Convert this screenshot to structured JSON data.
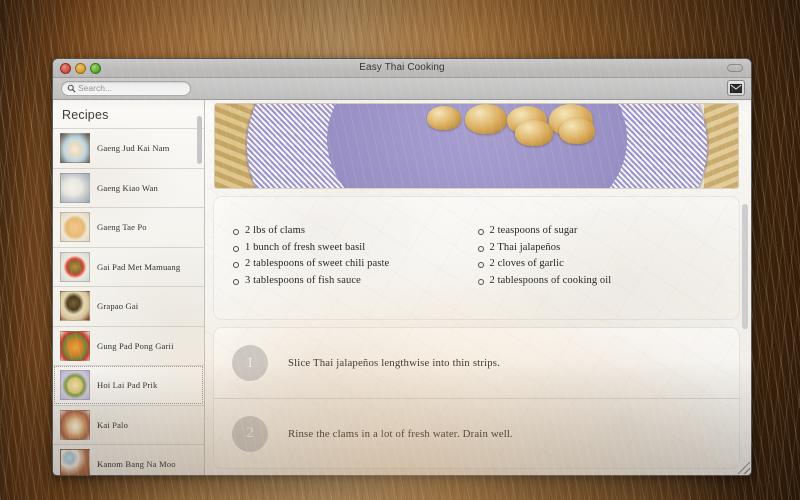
{
  "window": {
    "title": "Easy Thai Cooking",
    "controls": {
      "close": "close-button",
      "minimize": "minimize-button",
      "zoom": "zoom-button"
    },
    "toolbar_toggle": "toolbar-toggle"
  },
  "toolbar": {
    "search_placeholder": "Search...",
    "search_value": "",
    "search_icon": "search-icon",
    "mail_icon": "mail-icon"
  },
  "sidebar": {
    "title": "Recipes",
    "selected_index": 6,
    "recipes": [
      {
        "name": "Gaeng Jud Kai Nam"
      },
      {
        "name": "Gaeng Kiao Wan"
      },
      {
        "name": "Gaeng Tae Po"
      },
      {
        "name": "Gai Pad Met Mamuang"
      },
      {
        "name": "Grapao Gai"
      },
      {
        "name": "Gung Pad Pong Garii"
      },
      {
        "name": "Hoi Lai Pad Prik"
      },
      {
        "name": "Kai Palo"
      },
      {
        "name": "Kanom Bang Na Moo"
      }
    ]
  },
  "recipe": {
    "ingredients_left": [
      "2 lbs of clams",
      "1 bunch of fresh sweet basil",
      "2 tablespoons of sweet chili paste",
      "3 tablespoons of fish sauce"
    ],
    "ingredients_right": [
      "2 teaspoons of sugar",
      "2 Thai jalapeños",
      "2 cloves of garlic",
      "2 tablespoons of cooking oil"
    ],
    "steps": [
      {
        "number": "1",
        "text": "Slice Thai jalapeños lengthwise into thin strips."
      },
      {
        "number": "2",
        "text": "Rinse the clams in a lot of fresh water. Drain well."
      }
    ]
  },
  "colors": {
    "accent_plate": "#9a92c6",
    "step_circle": "#c9c9c9",
    "paper": "#f5f3ef",
    "desktop": "#b9803f"
  }
}
